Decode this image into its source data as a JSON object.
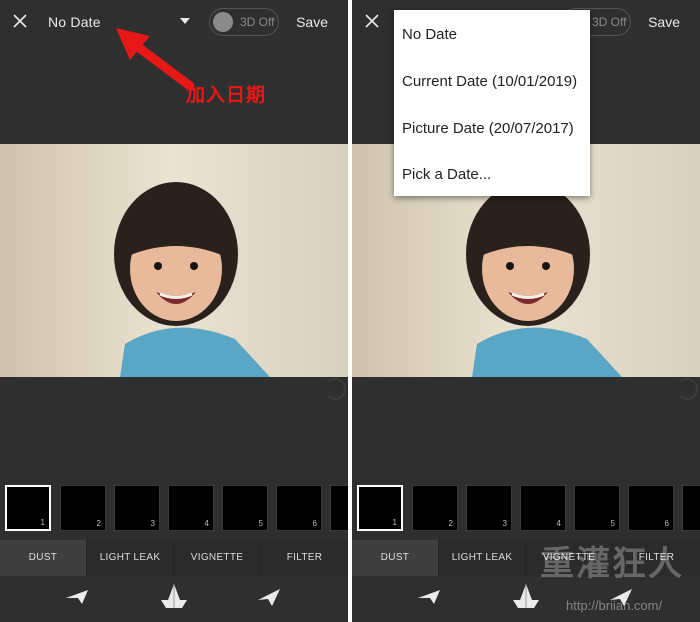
{
  "left": {
    "topbar": {
      "date_label": "No Date",
      "toggle_label": "3D Off",
      "save_label": "Save"
    },
    "thumbnails": [
      "1",
      "2",
      "3",
      "4",
      "5",
      "6"
    ],
    "tabs": [
      "DUST",
      "LIGHT LEAK",
      "VIGNETTE",
      "FILTER"
    ],
    "annotation": "加入日期"
  },
  "right": {
    "topbar": {
      "toggle_label": "3D Off",
      "save_label": "Save"
    },
    "dropdown": [
      "No Date",
      "Current Date (10/01/2019)",
      "Picture Date (20/07/2017)",
      "Pick a Date..."
    ],
    "thumbnails": [
      "1",
      "2",
      "3",
      "4",
      "5",
      "6"
    ],
    "tabs": [
      "DUST",
      "LIGHT LEAK",
      "VIGNETTE",
      "FILTER"
    ],
    "watermark": "重灌狂人",
    "watermark_url": "http://briian.com/"
  },
  "icons": [
    "close-icon",
    "dropdown-arrow-icon",
    "paper-plane-left-icon",
    "paper-boat-icon",
    "paper-plane-right-icon"
  ],
  "colors": {
    "background": "#2f2f2f",
    "annotation": "#e81818",
    "dropdown": "#ffffff"
  }
}
